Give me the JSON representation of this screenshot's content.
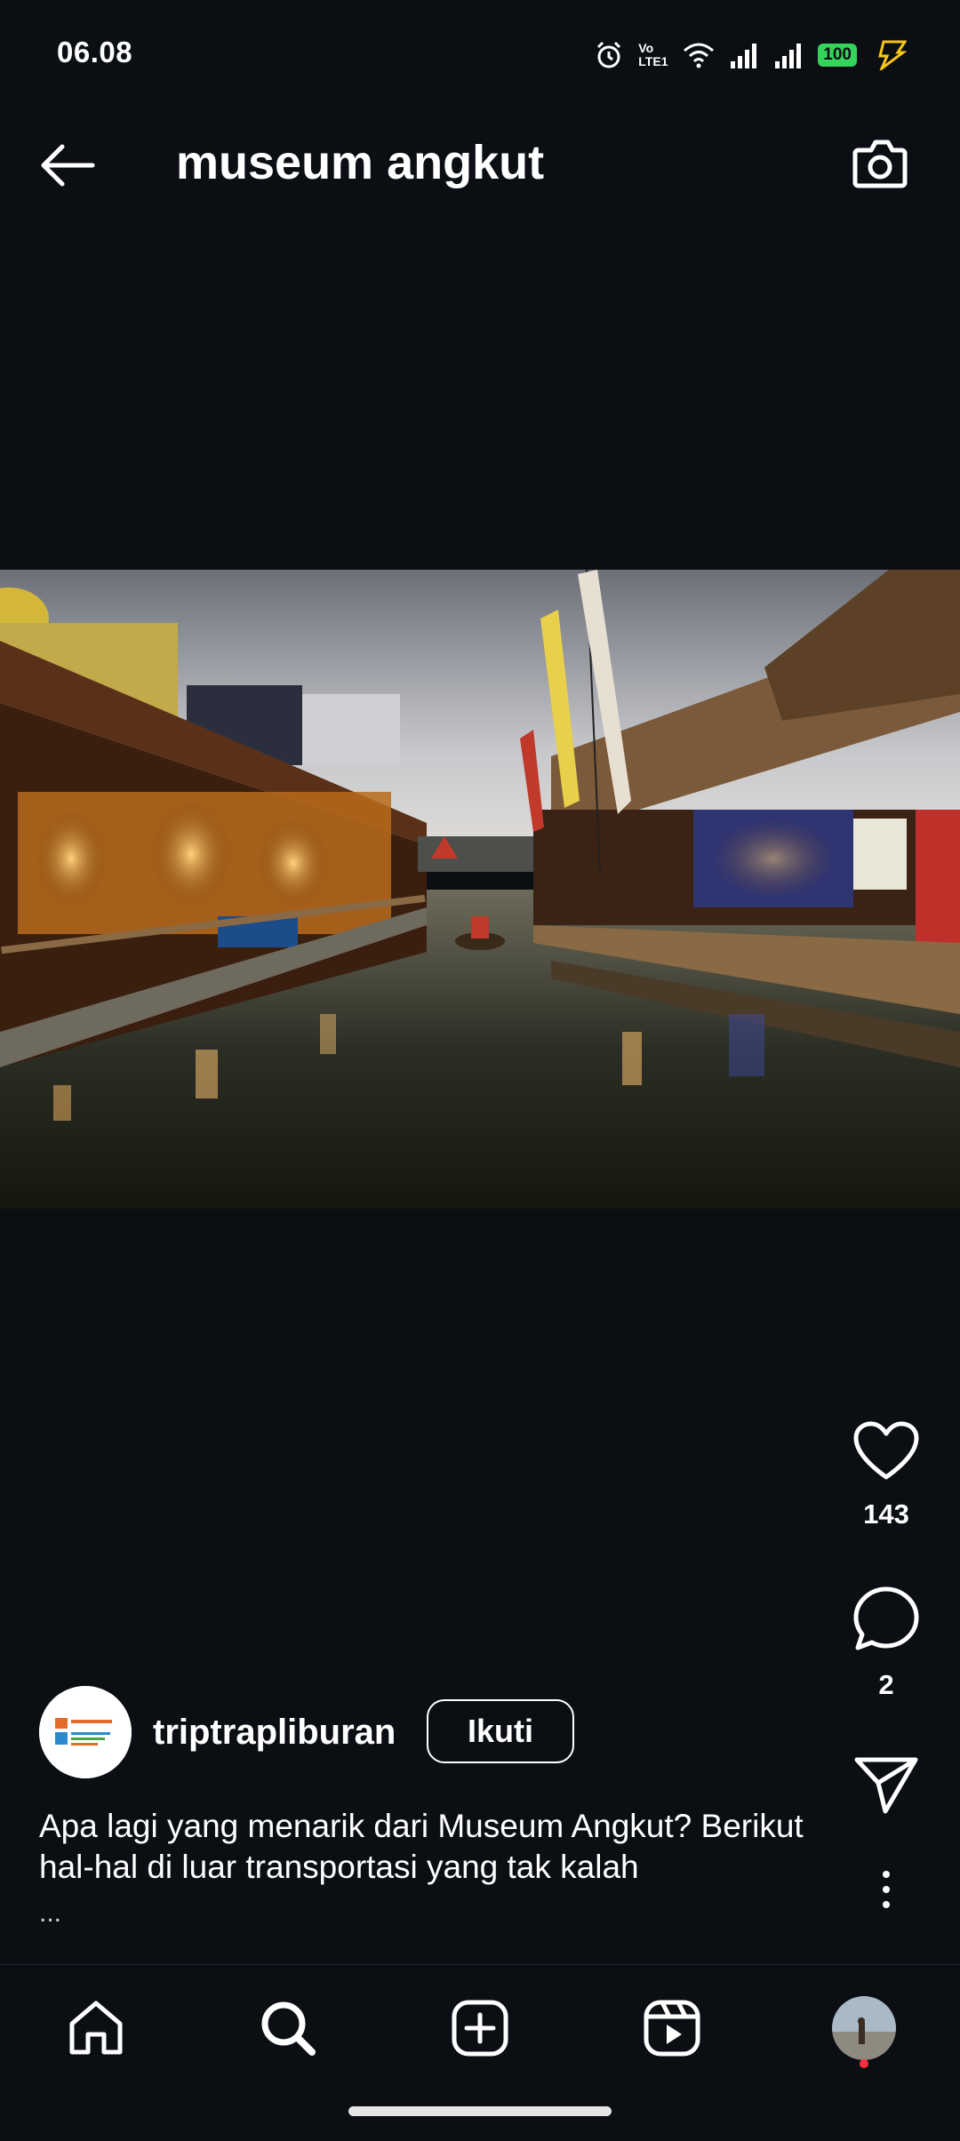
{
  "status_bar": {
    "time": "06.08",
    "network_label": "Vo LTE1",
    "battery": "100"
  },
  "header": {
    "title": "museum angkut",
    "back_icon": "arrow-left-icon",
    "camera_icon": "camera-icon"
  },
  "post": {
    "likes": "143",
    "comments": "2",
    "author": "triptrapliburan",
    "follow_label": "Ikuti",
    "caption": "Apa lagi yang menarik dari Museum Angkut? Berikut hal-hal di luar transportasi yang tak kalah",
    "caption_more": "..."
  },
  "bottom_nav": {
    "items": [
      "home-icon",
      "search-icon",
      "create-icon",
      "reels-icon",
      "profile-avatar"
    ]
  },
  "colors": {
    "background": "#0b0f14",
    "battery": "#35d35b",
    "notification_dot": "#ff3040"
  }
}
